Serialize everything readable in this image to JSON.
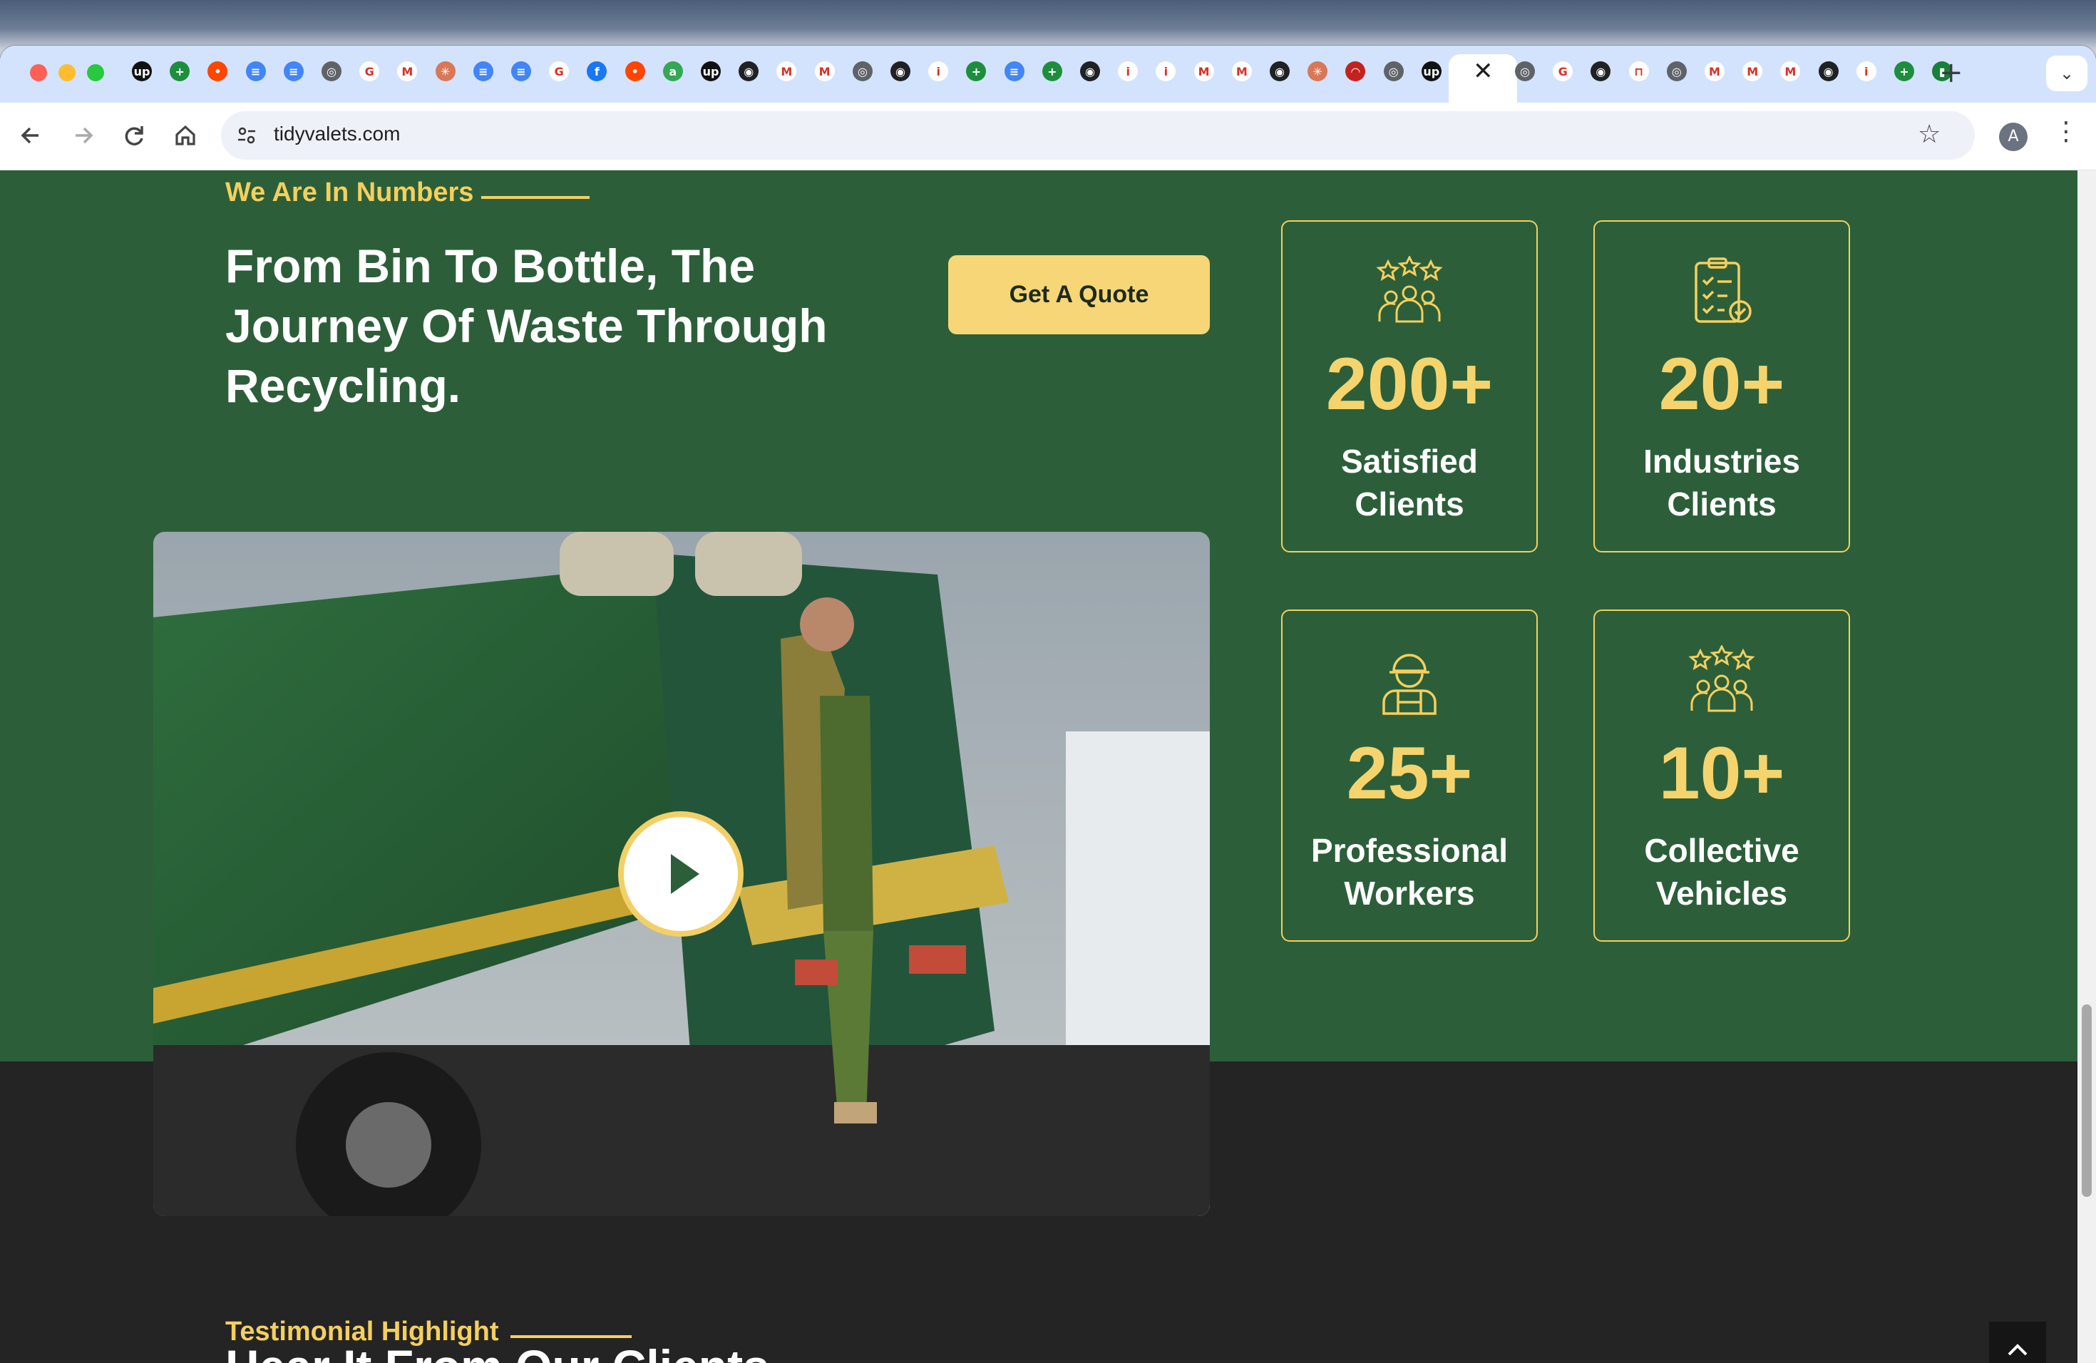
{
  "browser": {
    "url": "tidyvalets.com",
    "close_tab_glyph": "✕",
    "new_tab_glyph": "+",
    "tab_menu_glyph": "⌄",
    "profile_initial": "A",
    "tab_icons": [
      "upwork-icon",
      "sheets-icon",
      "reddit-icon",
      "docs-icon",
      "docs-icon",
      "chrome-icon",
      "google-icon",
      "gmail-icon",
      "claude-icon",
      "docs-icon",
      "docs-icon",
      "google-icon",
      "facebook-icon",
      "reddit-icon",
      "android-icon",
      "upwork-icon",
      "openai-icon",
      "gmail-icon",
      "gmail-icon",
      "chrome-icon",
      "openai-icon",
      "info-icon",
      "sheets-icon",
      "docs-icon",
      "sheets-icon",
      "openai-icon",
      "info-icon",
      "info-icon",
      "gmail-icon",
      "gmail-icon",
      "openai-icon",
      "claude-icon",
      "acrobat-icon",
      "chrome-icon",
      "upwork-icon",
      "bolt-icon",
      "app-icon"
    ],
    "tab_icons_after": [
      "chrome-icon",
      "google-icon",
      "openai-icon",
      "bracket-icon",
      "chrome-icon",
      "gmail-icon",
      "gmail-icon",
      "gmail-icon",
      "openai-icon",
      "info-icon",
      "sheets-icon",
      "mic-icon"
    ]
  },
  "numbers_section": {
    "eyebrow": "We Are In Numbers",
    "headline": "From Bin To Bottle, The Journey Of Waste Through Recycling.",
    "cta_label": "Get A Quote",
    "stats": [
      {
        "value": "200+",
        "label": "Satisfied Clients",
        "icon": "rating-group-icon"
      },
      {
        "value": "20+",
        "label": "Industries Clients",
        "icon": "checklist-icon"
      },
      {
        "value": "25+",
        "label": "Professional Workers",
        "icon": "worker-icon"
      },
      {
        "value": "10+",
        "label": "Collective Vehicles",
        "icon": "rating-group-icon"
      }
    ]
  },
  "testimonial_section": {
    "eyebrow": "Testimonial Highlight",
    "title": "Hear It From Our Clients"
  },
  "back_to_top_glyph": "⌃",
  "colors": {
    "section_green": "#2c5f39",
    "accent_yellow": "#f5cf5e",
    "dark_section": "#242424"
  }
}
